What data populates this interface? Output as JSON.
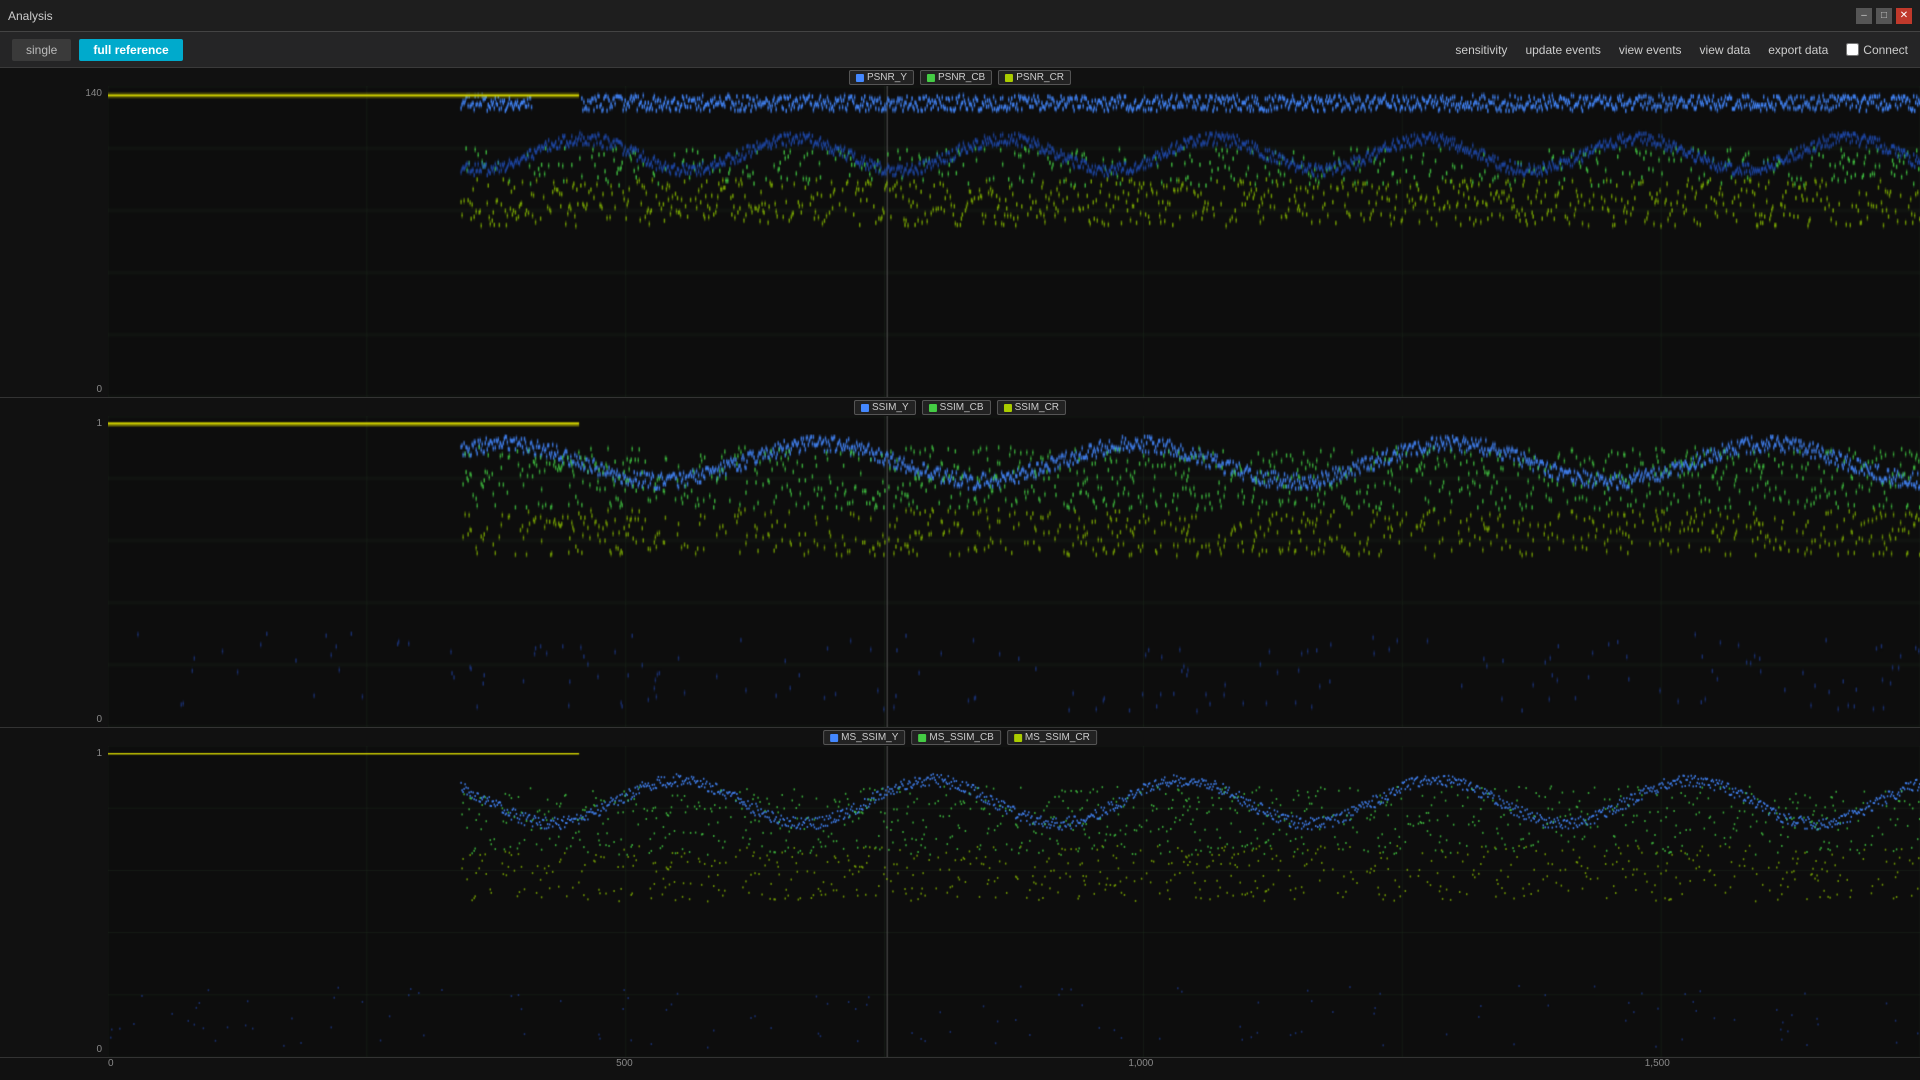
{
  "titleBar": {
    "title": "Analysis",
    "controls": [
      "minimize",
      "maximize",
      "close"
    ]
  },
  "tabs": {
    "single": "single",
    "fullRef": "full reference"
  },
  "toolbar": {
    "sensitivity": "sensitivity",
    "updateEvents": "update events",
    "viewEvents": "view events",
    "viewData": "view data",
    "exportData": "export data",
    "connect": "Connect"
  },
  "charts": [
    {
      "id": "psnr",
      "yMax": "140",
      "yMin": "0",
      "legend": [
        {
          "label": "PSNR_Y",
          "color": "#4488ff"
        },
        {
          "label": "PSNR_CB",
          "color": "#44cc44"
        },
        {
          "label": "PSNR_CR",
          "color": "#aacc00"
        }
      ]
    },
    {
      "id": "ssim",
      "yMax": "1",
      "yMin": "0",
      "legend": [
        {
          "label": "SSIM_Y",
          "color": "#4488ff"
        },
        {
          "label": "SSIM_CB",
          "color": "#44cc44"
        },
        {
          "label": "SSIM_CR",
          "color": "#aacc00"
        }
      ]
    },
    {
      "id": "msssim",
      "yMax": "1",
      "yMin": "0",
      "legend": [
        {
          "label": "MS_SSIM_Y",
          "color": "#4488ff"
        },
        {
          "label": "MS_SSIM_CB",
          "color": "#44cc44"
        },
        {
          "label": "MS_SSIM_CR",
          "color": "#aacc00"
        }
      ]
    }
  ],
  "xAxis": {
    "labels": [
      "0",
      "500",
      "1,000",
      "1,500"
    ],
    "positions": [
      0,
      0.285,
      0.57,
      0.856
    ]
  }
}
